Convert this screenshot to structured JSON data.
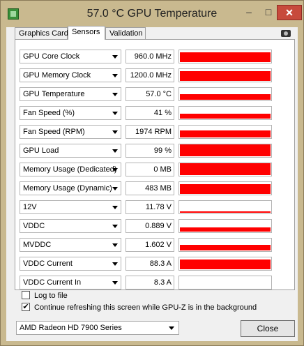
{
  "window": {
    "title": "57.0 °C GPU Temperature",
    "minimize_label": "–",
    "maximize_label": "□",
    "close_label": "✕"
  },
  "tabs": [
    {
      "label": "Graphics Card"
    },
    {
      "label": "Sensors"
    },
    {
      "label": "Validation"
    }
  ],
  "sensors": [
    {
      "name": "GPU Core Clock",
      "value": "960.0 MHz",
      "level": 0.75
    },
    {
      "name": "GPU Memory Clock",
      "value": "1200.0 MHz",
      "level": 0.75
    },
    {
      "name": "GPU Temperature",
      "value": "57.0 °C",
      "level": 0.45
    },
    {
      "name": "Fan Speed (%)",
      "value": "41 %",
      "level": 0.4
    },
    {
      "name": "Fan Speed (RPM)",
      "value": "1974 RPM",
      "level": 0.55
    },
    {
      "name": "GPU Load",
      "value": "99 %",
      "level": 0.97
    },
    {
      "name": "Memory Usage (Dedicated)",
      "value": "0 MB",
      "level": 0.95
    },
    {
      "name": "Memory Usage (Dynamic)",
      "value": "483 MB",
      "level": 0.8
    },
    {
      "name": "12V",
      "value": "11.78 V",
      "level": 0.1
    },
    {
      "name": "VDDC",
      "value": "0.889 V",
      "level": 0.35
    },
    {
      "name": "MVDDC",
      "value": "1.602 V",
      "level": 0.45
    },
    {
      "name": "VDDC Current",
      "value": "88.3 A",
      "level": 0.75
    },
    {
      "name": "VDDC Current In",
      "value": "8.3 A",
      "level": 0.0
    }
  ],
  "options": {
    "log_to_file": {
      "label": "Log to file",
      "checked": false
    },
    "continue_refreshing": {
      "label": "Continue refreshing this screen while GPU-Z is in the background",
      "checked": true,
      "mark": "✔"
    }
  },
  "footer": {
    "gpu_select_value": "AMD Radeon HD 7900 Series",
    "close_button": "Close"
  },
  "colors": {
    "graph_fill": "#ff0000",
    "close_button_bg": "#c74a3c"
  },
  "icons": [
    "gpu-z-app-icon",
    "camera-icon",
    "chevron-down-icon",
    "checkmark-icon"
  ]
}
